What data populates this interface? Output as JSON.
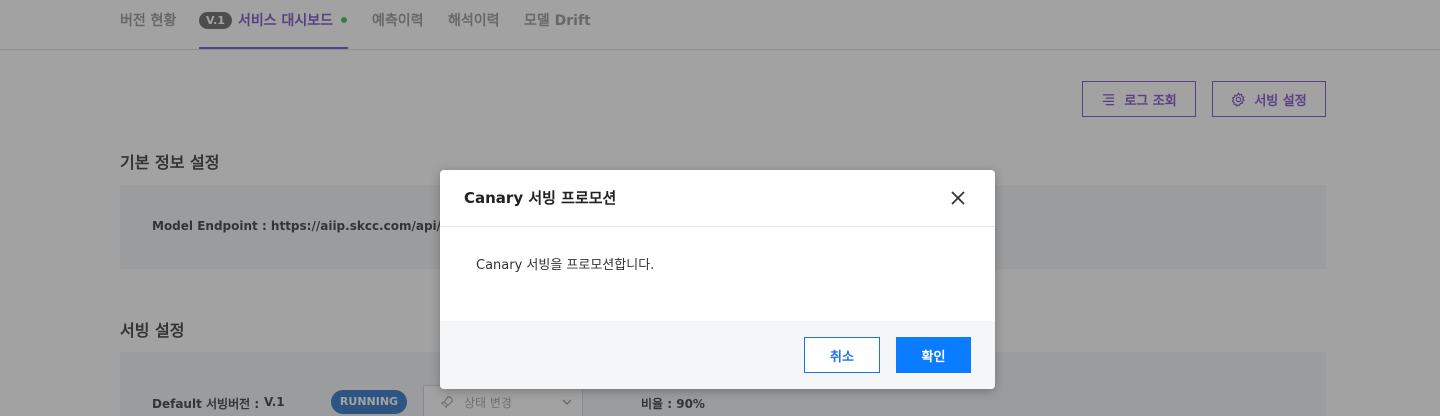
{
  "tabs": {
    "items": [
      {
        "label": "버전 현황"
      },
      {
        "label": "서비스 대시보드",
        "badge": "V.1"
      },
      {
        "label": "예측이력"
      },
      {
        "label": "해석이력"
      },
      {
        "label": "모델 Drift"
      }
    ],
    "active_index": 1
  },
  "toolbar": {
    "log_label": "로그 조회",
    "serving_settings_label": "서빙 설정"
  },
  "basic_info": {
    "title": "기본 정보 설정",
    "endpoint_text": "Model Endpoint : https://aiip.skcc.com/api/runtim"
  },
  "serving": {
    "title": "서빙 설정",
    "default_version_label": "Default 서빙버전 :",
    "default_version_value": "V.1",
    "status": "RUNNING",
    "status_select_placeholder": "상태 변경",
    "ratio_text": "비율 : 90%"
  },
  "modal": {
    "title": "Canary 서빙 프로모션",
    "message": "Canary 서빙을 프로모션합니다.",
    "cancel_label": "취소",
    "confirm_label": "확인"
  },
  "colors": {
    "accent": "#6a3cc0",
    "primary_button": "#0a7cff",
    "status_running": "#1565c0",
    "live_dot": "#22b14c"
  }
}
